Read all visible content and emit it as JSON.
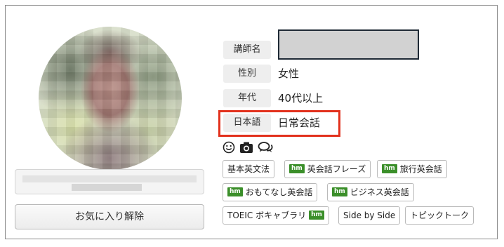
{
  "profile": {
    "favorite_button_label": "お気に入り解除"
  },
  "info": {
    "teacher_name_label": "講師名",
    "gender_label": "性別",
    "gender_value": "女性",
    "age_label": "年代",
    "age_value": "40代以上",
    "japanese_label": "日本語",
    "japanese_value": "日常会話"
  },
  "icons": [
    "smiley-icon",
    "camera-icon",
    "chat-bubbles-icon"
  ],
  "tags": {
    "hm_badge": "hm",
    "basic_grammar": "基本英文法",
    "conversation_phrases": "英会話フレーズ",
    "travel_english": "旅行英会話",
    "hospitality_english": "おもてなし英会話",
    "business_english": "ビジネス英会話",
    "toeic_vocab": "TOEIC ボキャブラリ",
    "side_by_side": "Side by Side",
    "topic_talk": "トピックトーク"
  },
  "colors": {
    "highlight": "#e2311d",
    "hm_badge": "#3b8f2a",
    "label_bg": "#eeeeee"
  }
}
